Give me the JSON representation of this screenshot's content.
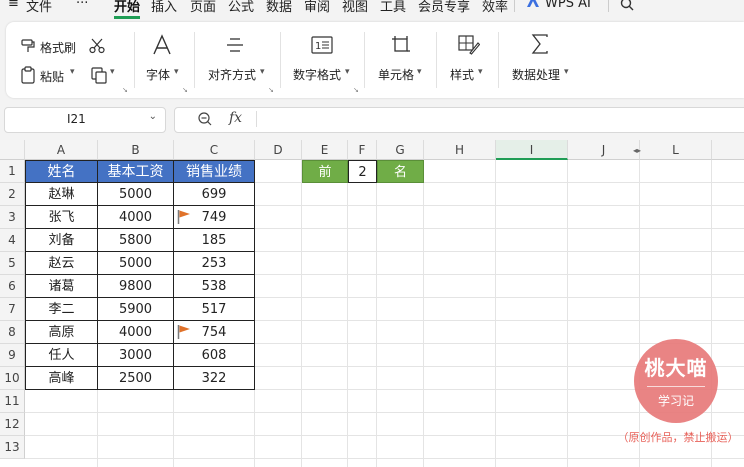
{
  "menubar": {
    "hamburger": "≡",
    "file": "文件",
    "more": "···",
    "tabs": [
      "开始",
      "插入",
      "页面",
      "公式",
      "数据",
      "审阅",
      "视图",
      "工具",
      "会员专享",
      "效率"
    ],
    "wps_ai": "WPS AI"
  },
  "ribbon": {
    "format_painter": "格式刷",
    "paste": "粘贴",
    "font": "字体",
    "align": "对齐方式",
    "number_format": "数字格式",
    "cell": "单元格",
    "style": "样式",
    "data_processing": "数据处理"
  },
  "formula_bar": {
    "name_box": "I21",
    "fx": "fx",
    "formula": ""
  },
  "columns": [
    "A",
    "B",
    "C",
    "D",
    "E",
    "F",
    "G",
    "H",
    "I",
    "J",
    "L"
  ],
  "rows": [
    "1",
    "2",
    "3",
    "4",
    "5",
    "6",
    "7",
    "8",
    "9",
    "10",
    "11",
    "12",
    "13"
  ],
  "table": {
    "headers": [
      "姓名",
      "基本工资",
      "销售业绩"
    ],
    "rows": [
      [
        "赵琳",
        "5000",
        "699"
      ],
      [
        "张飞",
        "4000",
        "749"
      ],
      [
        "刘备",
        "5800",
        "185"
      ],
      [
        "赵云",
        "5000",
        "253"
      ],
      [
        "诸葛",
        "9800",
        "538"
      ],
      [
        "李二",
        "5900",
        "517"
      ],
      [
        "高原",
        "4000",
        "754"
      ],
      [
        "任人",
        "3000",
        "608"
      ],
      [
        "高峰",
        "2500",
        "322"
      ]
    ],
    "flagged_rows": [
      1,
      6
    ],
    "header_color": "#4472c4",
    "flag_color": "#e0722a"
  },
  "topn": {
    "front": "前",
    "n": "2",
    "rank": "名",
    "color": "#70ad47"
  },
  "watermark": {
    "name": "桃大喵",
    "sub": "学习记",
    "notice": "（原创作品，禁止搬运）",
    "color": "#e87a7a"
  }
}
